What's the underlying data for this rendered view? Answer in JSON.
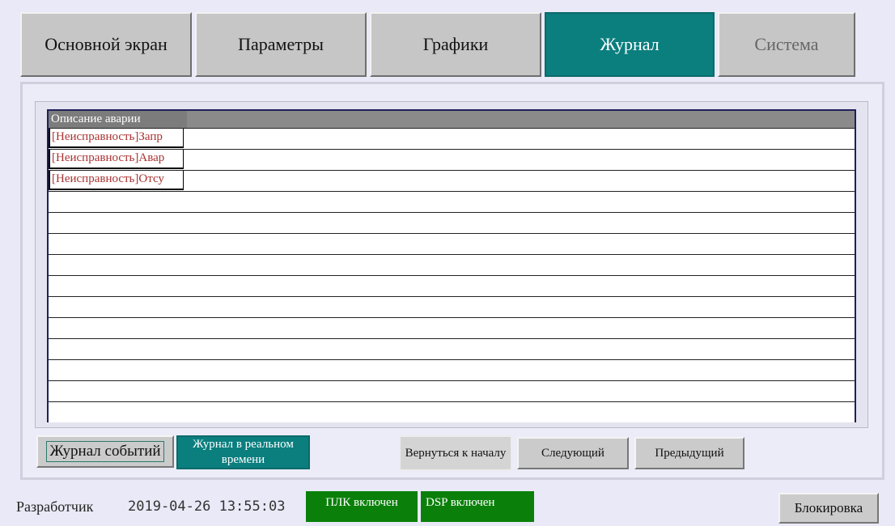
{
  "tabs": [
    {
      "label": "Основной экран",
      "state": "normal"
    },
    {
      "label": "Параметры",
      "state": "normal"
    },
    {
      "label": "Графики",
      "state": "normal"
    },
    {
      "label": "Журнал",
      "state": "active"
    },
    {
      "label": "Система",
      "state": "disabled"
    }
  ],
  "table": {
    "header": "Описание аварии",
    "rows": [
      "[Неисправность]Запр",
      "[Неисправность]Авар",
      "[Неисправность]Отсу",
      "",
      "",
      "",
      "",
      "",
      "",
      "",
      "",
      "",
      "",
      ""
    ]
  },
  "buttons": {
    "event_log": "Журнал событий",
    "realtime_log": "Журнал в реальном времени",
    "go_start": "Вернуться к началу",
    "next": "Следующий",
    "prev": "Предыдущий",
    "lock": "Блокировка"
  },
  "status": {
    "user": "Разработчик",
    "datetime": "2019-04-26 13:55:03",
    "plc": "ПЛК включен",
    "dsp": "DSP включен"
  },
  "colors": {
    "active_tab": "#0b7e7e",
    "status_ok": "#0a800a",
    "fault_text": "#a33333"
  }
}
